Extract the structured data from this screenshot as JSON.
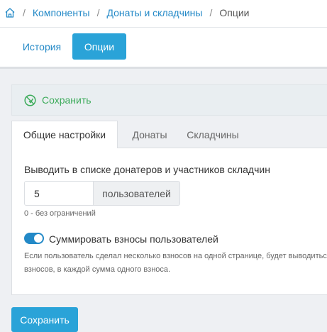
{
  "breadcrumb": {
    "home_icon": "home-icon",
    "items": [
      "Компоненты",
      "Донаты и складчины"
    ],
    "current": "Опции"
  },
  "top_tabs": {
    "history": "История",
    "options": "Опции"
  },
  "save_bar": {
    "icon": "save-icon",
    "label": "Сохранить"
  },
  "settings_tabs": {
    "general": "Общие настройки",
    "donates": "Донаты",
    "collects": "Складчины"
  },
  "form": {
    "list_label": "Выводить в списке донатеров и участников складчин",
    "count_value": "5",
    "count_unit": "пользователей",
    "count_hint": "0 - без ограничений",
    "sum_toggle": {
      "on": true,
      "label": "Суммировать взносы пользователей"
    },
    "sum_desc_line1": "Если пользователь сделал несколько взносов на одной странице, будет выводиться",
    "sum_desc_line2": "взносов, в каждой сумма одного взноса."
  },
  "footer": {
    "save_label": "Сохранить"
  },
  "colors": {
    "accent": "#2aa3d8",
    "link": "#2389c7",
    "success": "#3cab5a"
  }
}
